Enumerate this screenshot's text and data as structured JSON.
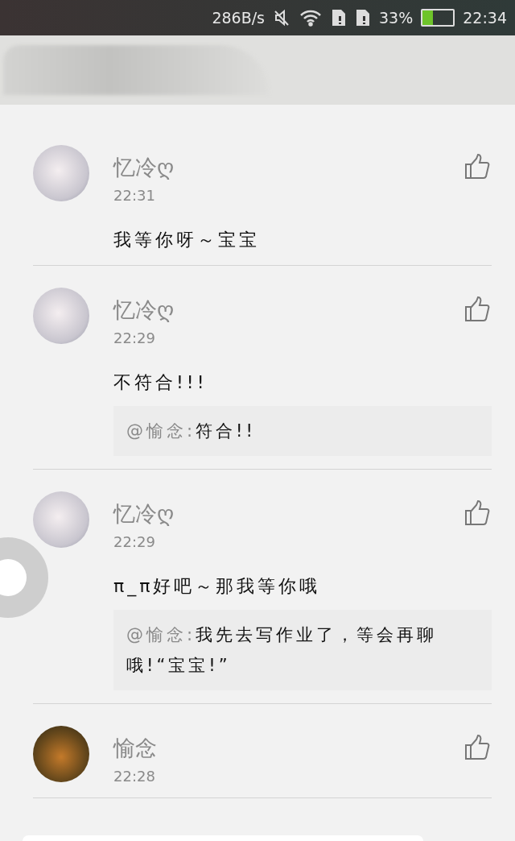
{
  "status_bar": {
    "speed": "286B/s",
    "battery": "33%",
    "time": "22:34"
  },
  "comments": [
    {
      "name": "忆冷ღ",
      "time": "22:31",
      "text": "我等你呀～宝宝",
      "kind": "drawn-avatar"
    },
    {
      "name": "忆冷ღ",
      "time": "22:29",
      "text": "不符合!!!",
      "kind": "drawn-avatar",
      "quote": {
        "author": "@愉念:",
        "text": "符合!!"
      }
    },
    {
      "name": "忆冷ღ",
      "time": "22:29",
      "text": "π_π好吧～那我等你哦",
      "kind": "drawn-avatar",
      "quote": {
        "author": "@愉念:",
        "text": "我先去写作业了，等会再聊哦!“宝宝!”"
      }
    },
    {
      "name": "愉念",
      "time": "22:28",
      "kind": "photo-avatar"
    }
  ]
}
